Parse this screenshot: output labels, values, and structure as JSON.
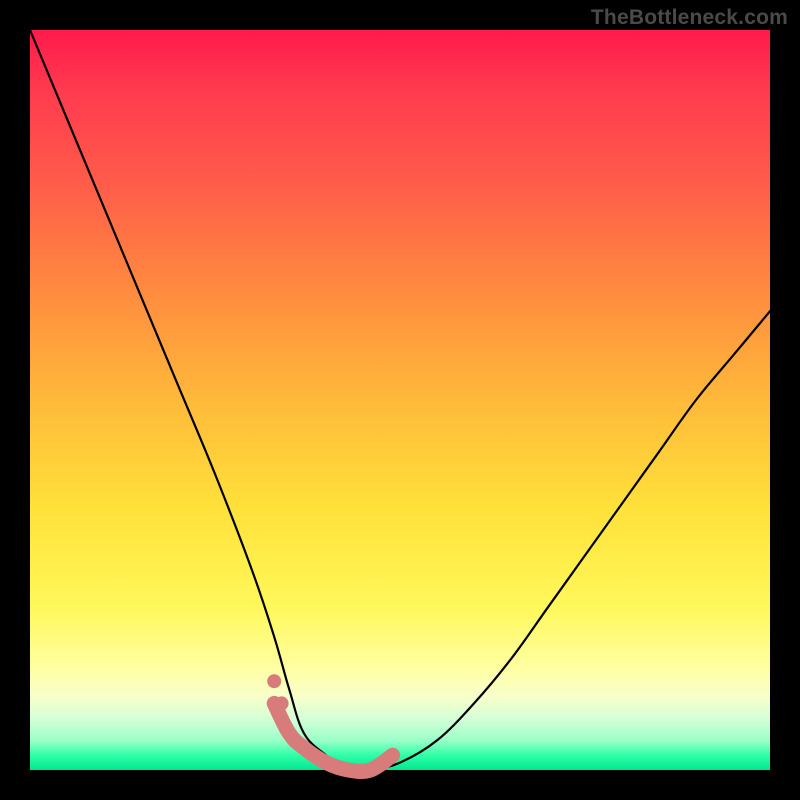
{
  "watermark": "TheBottleneck.com",
  "chart_data": {
    "type": "line",
    "title": "",
    "xlabel": "",
    "ylabel": "",
    "xlim": [
      0,
      100
    ],
    "ylim": [
      0,
      100
    ],
    "grid": false,
    "legend": false,
    "series": [
      {
        "name": "bottleneck-curve",
        "x": [
          0,
          5,
          10,
          15,
          20,
          25,
          30,
          33,
          35,
          37,
          40,
          43,
          46,
          50,
          55,
          60,
          65,
          70,
          75,
          80,
          85,
          90,
          95,
          100
        ],
        "y": [
          100,
          88,
          76,
          64,
          52,
          40,
          27,
          18,
          11,
          5,
          2,
          0,
          0,
          1,
          4,
          9,
          15,
          22,
          29,
          36,
          43,
          50,
          56,
          62
        ]
      }
    ],
    "highlight": {
      "name": "optimal-range",
      "x": [
        33,
        35,
        37,
        40,
        43,
        46,
        49
      ],
      "y": [
        9,
        5,
        3,
        1,
        0,
        0,
        2
      ]
    },
    "background_gradient": {
      "top": "#ff1a4b",
      "mid": "#ffe23a",
      "bottom": "#00e890"
    }
  }
}
